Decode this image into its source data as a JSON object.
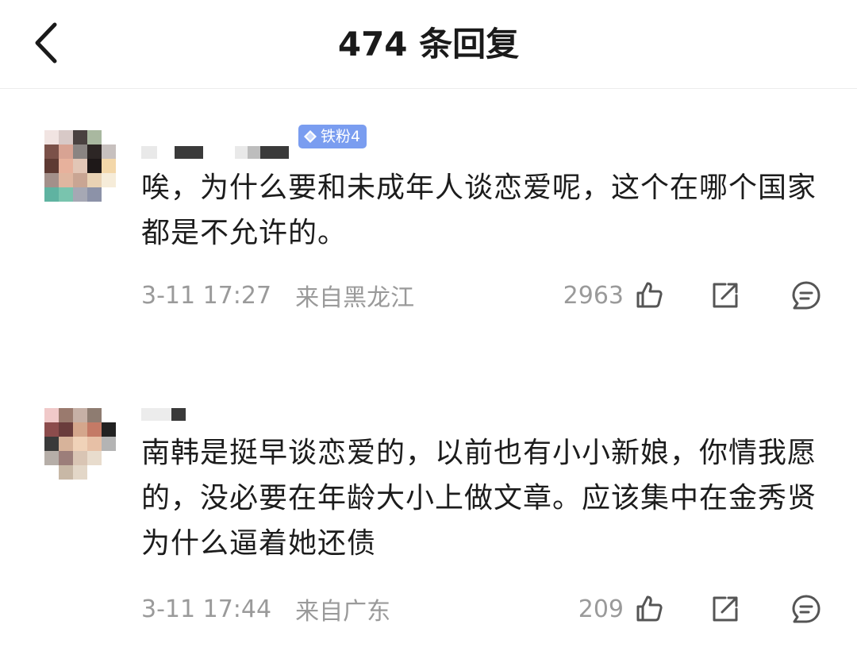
{
  "header": {
    "title": "474 条回复",
    "back_icon": "chevron-left-icon"
  },
  "comments": [
    {
      "badge": "铁粉4",
      "text": "唉，为什么要和未成年人谈恋爱呢，这个在哪个国家都是不允许的。",
      "time": "3-11 17:27",
      "location": "来自黑龙江",
      "likes": "2963",
      "icons": [
        "thumbs-up-icon",
        "share-icon",
        "comment-icon"
      ]
    },
    {
      "badge": "",
      "text": "南韩是挺早谈恋爱的，以前也有小小新娘，你情我愿的，没必要在年龄大小上做文章。应该集中在金秀贤为什么逼着她还债",
      "time": "3-11 17:44",
      "location": "来自广东",
      "likes": "209",
      "icons": [
        "thumbs-up-icon",
        "share-icon",
        "comment-icon"
      ]
    }
  ],
  "colors": {
    "badge": "#7a9df0",
    "meta_text": "#9a9a9a",
    "body_text": "#1c1c1c"
  }
}
